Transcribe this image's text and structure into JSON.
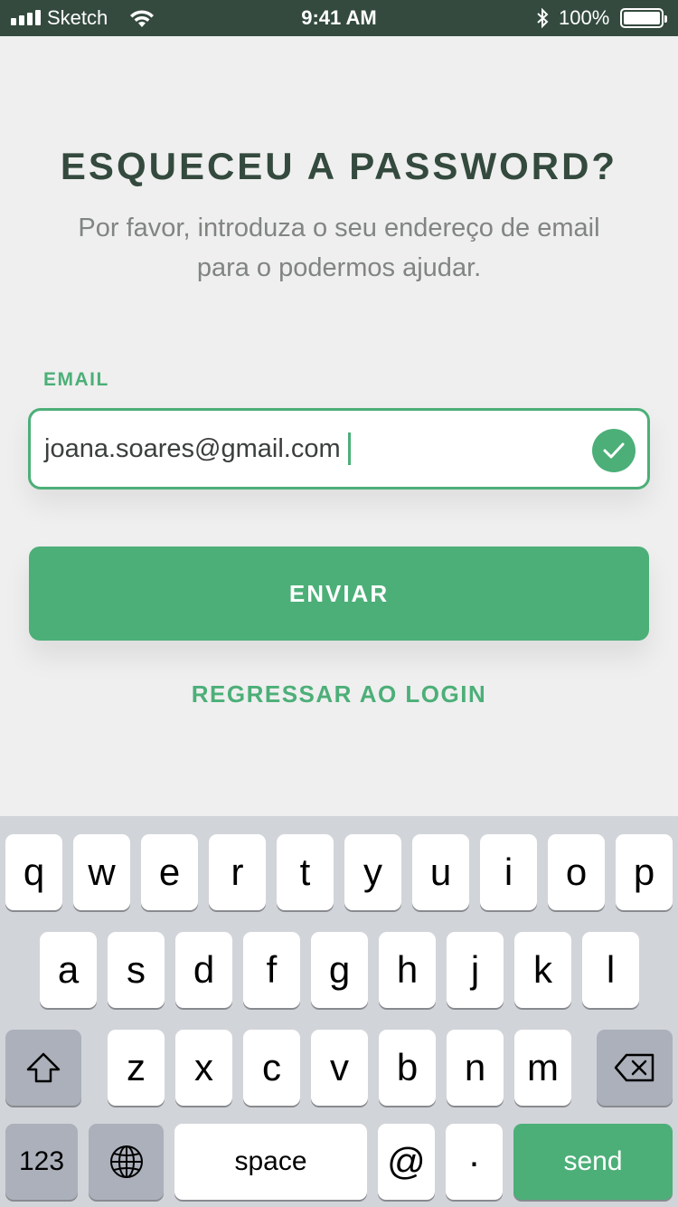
{
  "status_bar": {
    "carrier": "Sketch",
    "time": "9:41 AM",
    "battery_percent": "100%",
    "icons": [
      "signal-bars-icon",
      "wifi-icon",
      "bluetooth-icon",
      "battery-icon"
    ]
  },
  "screen": {
    "title": "ESQUECEU A PASSWORD?",
    "subtitle_line1": "Por favor, introduza o seu endereço de email",
    "subtitle_line2": "para o podermos ajudar.",
    "email_label": "EMAIL",
    "email_value": "joana.soares@gmail.com",
    "email_valid_icon": "check-circle-icon",
    "submit_label": "ENVIAR",
    "back_link": "REGRESSAR AO LOGIN"
  },
  "keyboard": {
    "row1": [
      "q",
      "w",
      "e",
      "r",
      "t",
      "y",
      "u",
      "i",
      "o",
      "p"
    ],
    "row2": [
      "a",
      "s",
      "d",
      "f",
      "g",
      "h",
      "j",
      "k",
      "l"
    ],
    "row3": [
      "z",
      "x",
      "c",
      "v",
      "b",
      "n",
      "m"
    ],
    "numbers_label": "123",
    "space_label": "space",
    "at_label": "@",
    "dot_label": "·",
    "send_label": "send",
    "shift_icon": "shift-icon",
    "backspace_icon": "backspace-icon",
    "globe_icon": "globe-icon"
  },
  "colors": {
    "accent": "#4caf78",
    "status_bar": "#344a3e",
    "title": "#344a3e",
    "subtitle": "#808582",
    "background": "#efefef",
    "keyboard": "#d1d4d9"
  }
}
